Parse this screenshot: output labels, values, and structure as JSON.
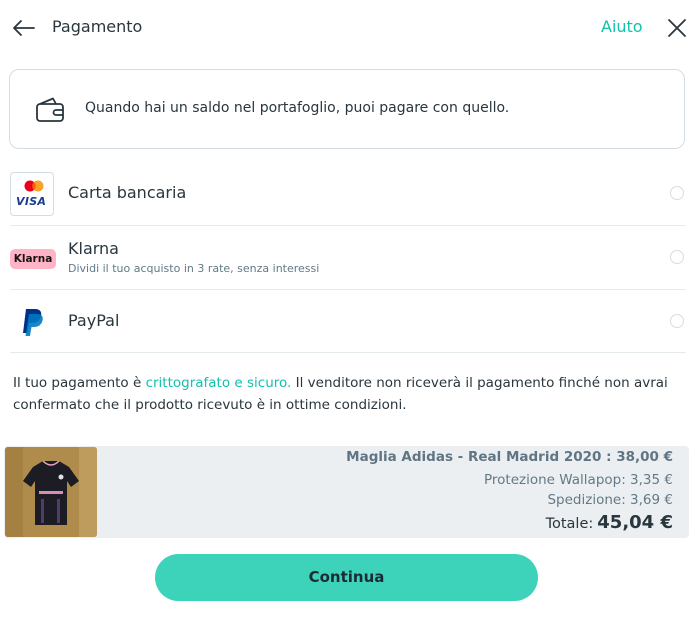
{
  "header": {
    "title": "Pagamento",
    "help_label": "Aiuto"
  },
  "wallet": {
    "message": "Quando hai un saldo nel portafoglio, puoi pagare con quello."
  },
  "payment_methods": [
    {
      "label": "Carta bancaria",
      "logo_text": "VISA",
      "selected": false
    },
    {
      "label": "Klarna",
      "subtitle": "Dividi il tuo acquisto in 3 rate, senza interessi",
      "logo_text": "Klarna",
      "selected": false
    },
    {
      "label": "PayPal",
      "selected": false
    }
  ],
  "secure_note": {
    "prefix": "Il tuo pagamento è ",
    "link": "crittografato e sicuro.",
    "suffix": " Il venditore non riceverà il pagamento finché non avrai confermato che il prodotto ricevuto è in ottime condizioni."
  },
  "summary": {
    "item": "Maglia Adidas - Real Madrid 2020 : 38,00 €",
    "protection": "Protezione Wallapop: 3,35 €",
    "shipping": "Spedizione: 3,69 €",
    "total_label": "Totale:",
    "total_value": "45,04 €"
  },
  "continue_label": "Continua",
  "colors": {
    "accent": "#13c1ac",
    "button": "#3dd2ba",
    "text": "#29363d",
    "muted": "#627a87",
    "klarna_pink": "#ffb3c7"
  }
}
